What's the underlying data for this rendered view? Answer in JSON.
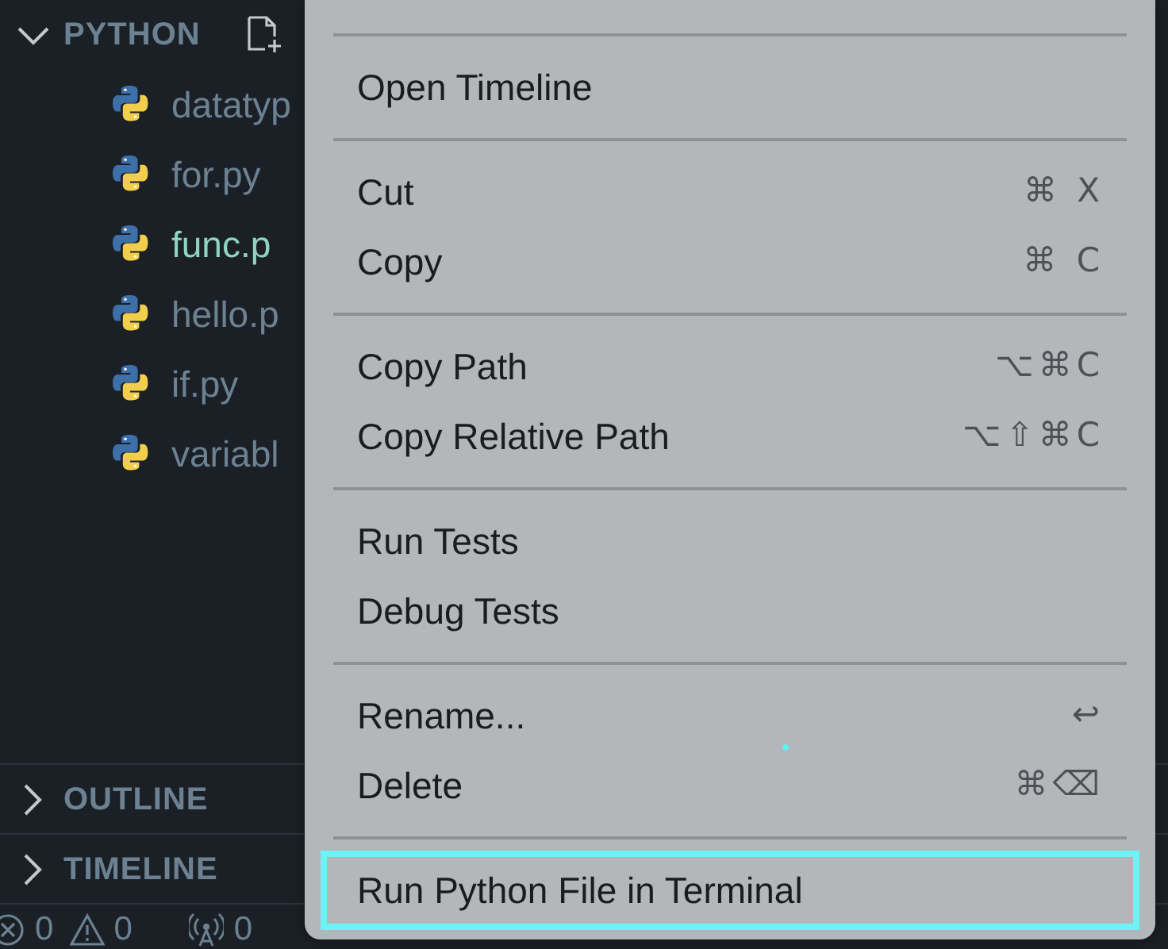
{
  "explorer": {
    "section": {
      "title": "PYTHON",
      "expanded": true
    },
    "files": [
      {
        "name": "datatyp",
        "color": "#6c8192"
      },
      {
        "name": "for.py",
        "color": "#6c8192"
      },
      {
        "name": "func.p",
        "color": "#8fd3c4"
      },
      {
        "name": "hello.p",
        "color": "#6c8192"
      },
      {
        "name": "if.py",
        "color": "#6c8192"
      },
      {
        "name": "variabl",
        "color": "#6c8192"
      }
    ],
    "panels": [
      {
        "title": "OUTLINE",
        "expanded": false
      },
      {
        "title": "TIMELINE",
        "expanded": false
      }
    ]
  },
  "status_bar": {
    "errors": "0",
    "warnings": "0",
    "ports": "0"
  },
  "context_menu": [
    {
      "kind": "separator"
    },
    {
      "kind": "item",
      "label": "Open Timeline",
      "selected": false
    },
    {
      "kind": "separator"
    },
    {
      "kind": "item",
      "label": "Cut",
      "shortcut": "⌘ X",
      "selected": false
    },
    {
      "kind": "item",
      "label": "Copy",
      "shortcut": "⌘ C",
      "selected": false
    },
    {
      "kind": "separator"
    },
    {
      "kind": "item",
      "label": "Copy Path",
      "shortcut": "⌥⌘C",
      "selected": false
    },
    {
      "kind": "item",
      "label": "Copy Relative Path",
      "shortcut": "⌥⇧⌘C",
      "selected": false
    },
    {
      "kind": "separator"
    },
    {
      "kind": "item",
      "label": "Run Tests",
      "selected": false
    },
    {
      "kind": "item",
      "label": "Debug Tests",
      "selected": false
    },
    {
      "kind": "separator"
    },
    {
      "kind": "item",
      "label": "Rename...",
      "shortcut": "↩",
      "selected": false
    },
    {
      "kind": "item",
      "label": "Delete",
      "shortcut": "⌘⌫",
      "selected": false
    },
    {
      "kind": "separator"
    },
    {
      "kind": "item",
      "label": "Run Python File in Terminal",
      "selected": true
    }
  ]
}
